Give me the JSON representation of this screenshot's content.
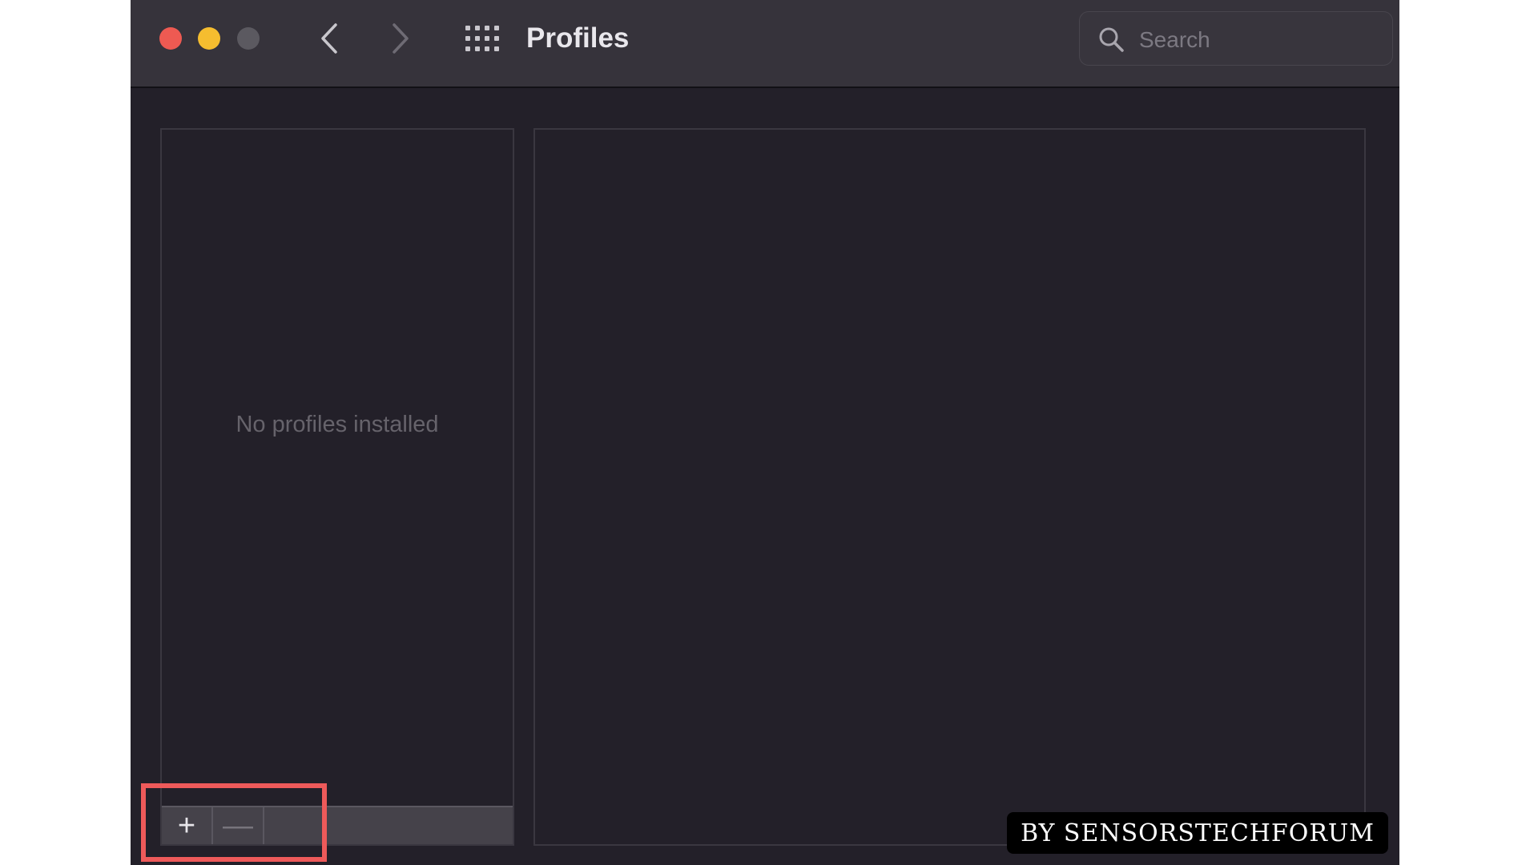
{
  "window": {
    "title": "Profiles"
  },
  "toolbar": {
    "back_icon": "chevron-left-icon",
    "forward_icon": "chevron-right-icon",
    "grid_icon": "grid-icon",
    "search": {
      "placeholder": "Search",
      "value": ""
    }
  },
  "profiles_list": {
    "empty_message": "No profiles installed",
    "add_label": "+",
    "remove_label": "—"
  },
  "watermark": {
    "text": "BY SENSORSTECHFORUM"
  },
  "colors": {
    "close": "#ee5a52",
    "minimize": "#f5bd2f",
    "zoom_disabled": "#5b5960",
    "highlight": "#ee5a5a",
    "window_bg": "#232029",
    "titlebar_bg": "#36333b"
  }
}
